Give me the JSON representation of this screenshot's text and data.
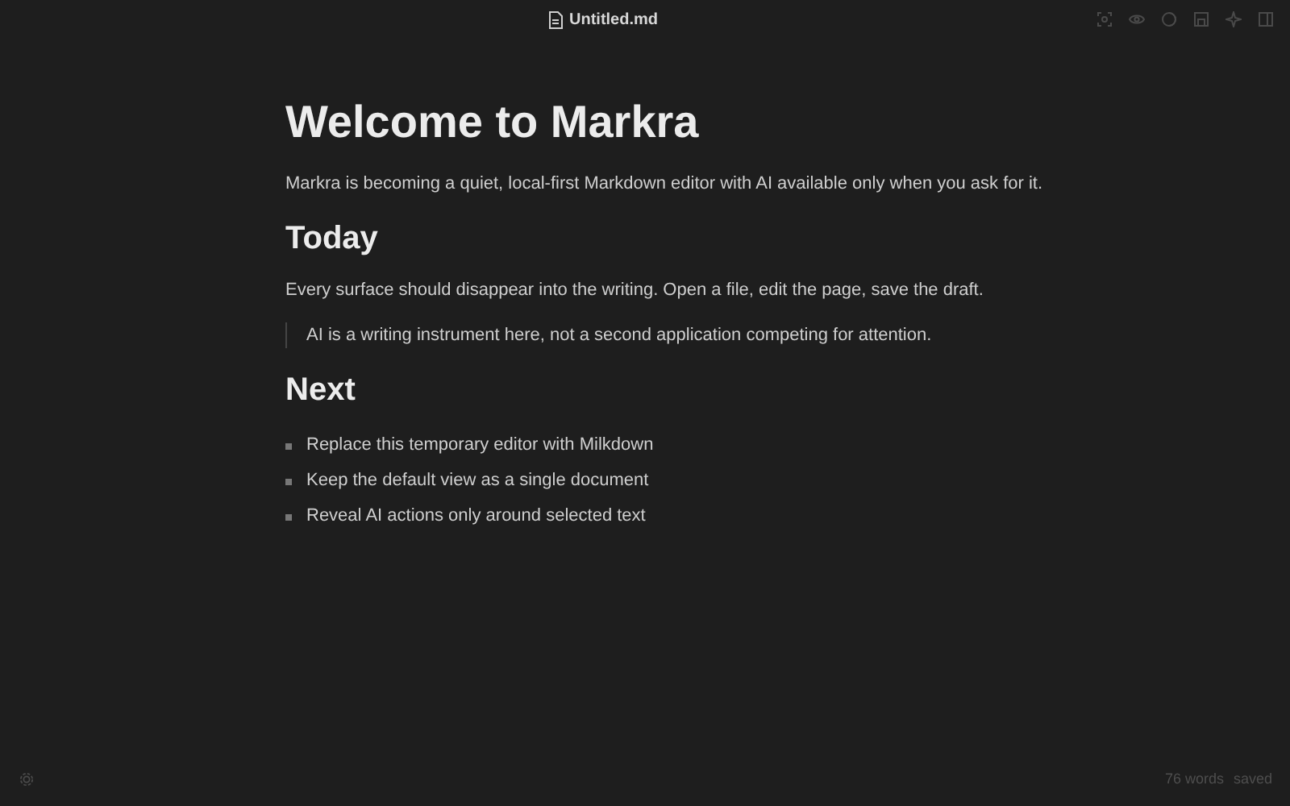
{
  "title_bar": {
    "filename": "Untitled.md"
  },
  "document": [
    {
      "kind": "h1",
      "text": "Welcome to Markra"
    },
    {
      "kind": "p",
      "text": "Markra is becoming a quiet, local-first Markdown editor with AI available only when you ask for it."
    },
    {
      "kind": "h2",
      "text": "Today"
    },
    {
      "kind": "p",
      "text": "Every surface should disappear into the writing. Open a file, edit the page, save the draft."
    },
    {
      "kind": "quote",
      "text": "AI is a writing instrument here, not a second application competing for attention."
    },
    {
      "kind": "h2",
      "text": "Next"
    },
    {
      "kind": "list",
      "items": [
        "Replace this temporary editor with Milkdown",
        "Keep the default view as a single document",
        "Reveal AI actions only around selected text"
      ]
    }
  ],
  "status_bar": {
    "word_count": "76 words",
    "save_state": "saved"
  }
}
